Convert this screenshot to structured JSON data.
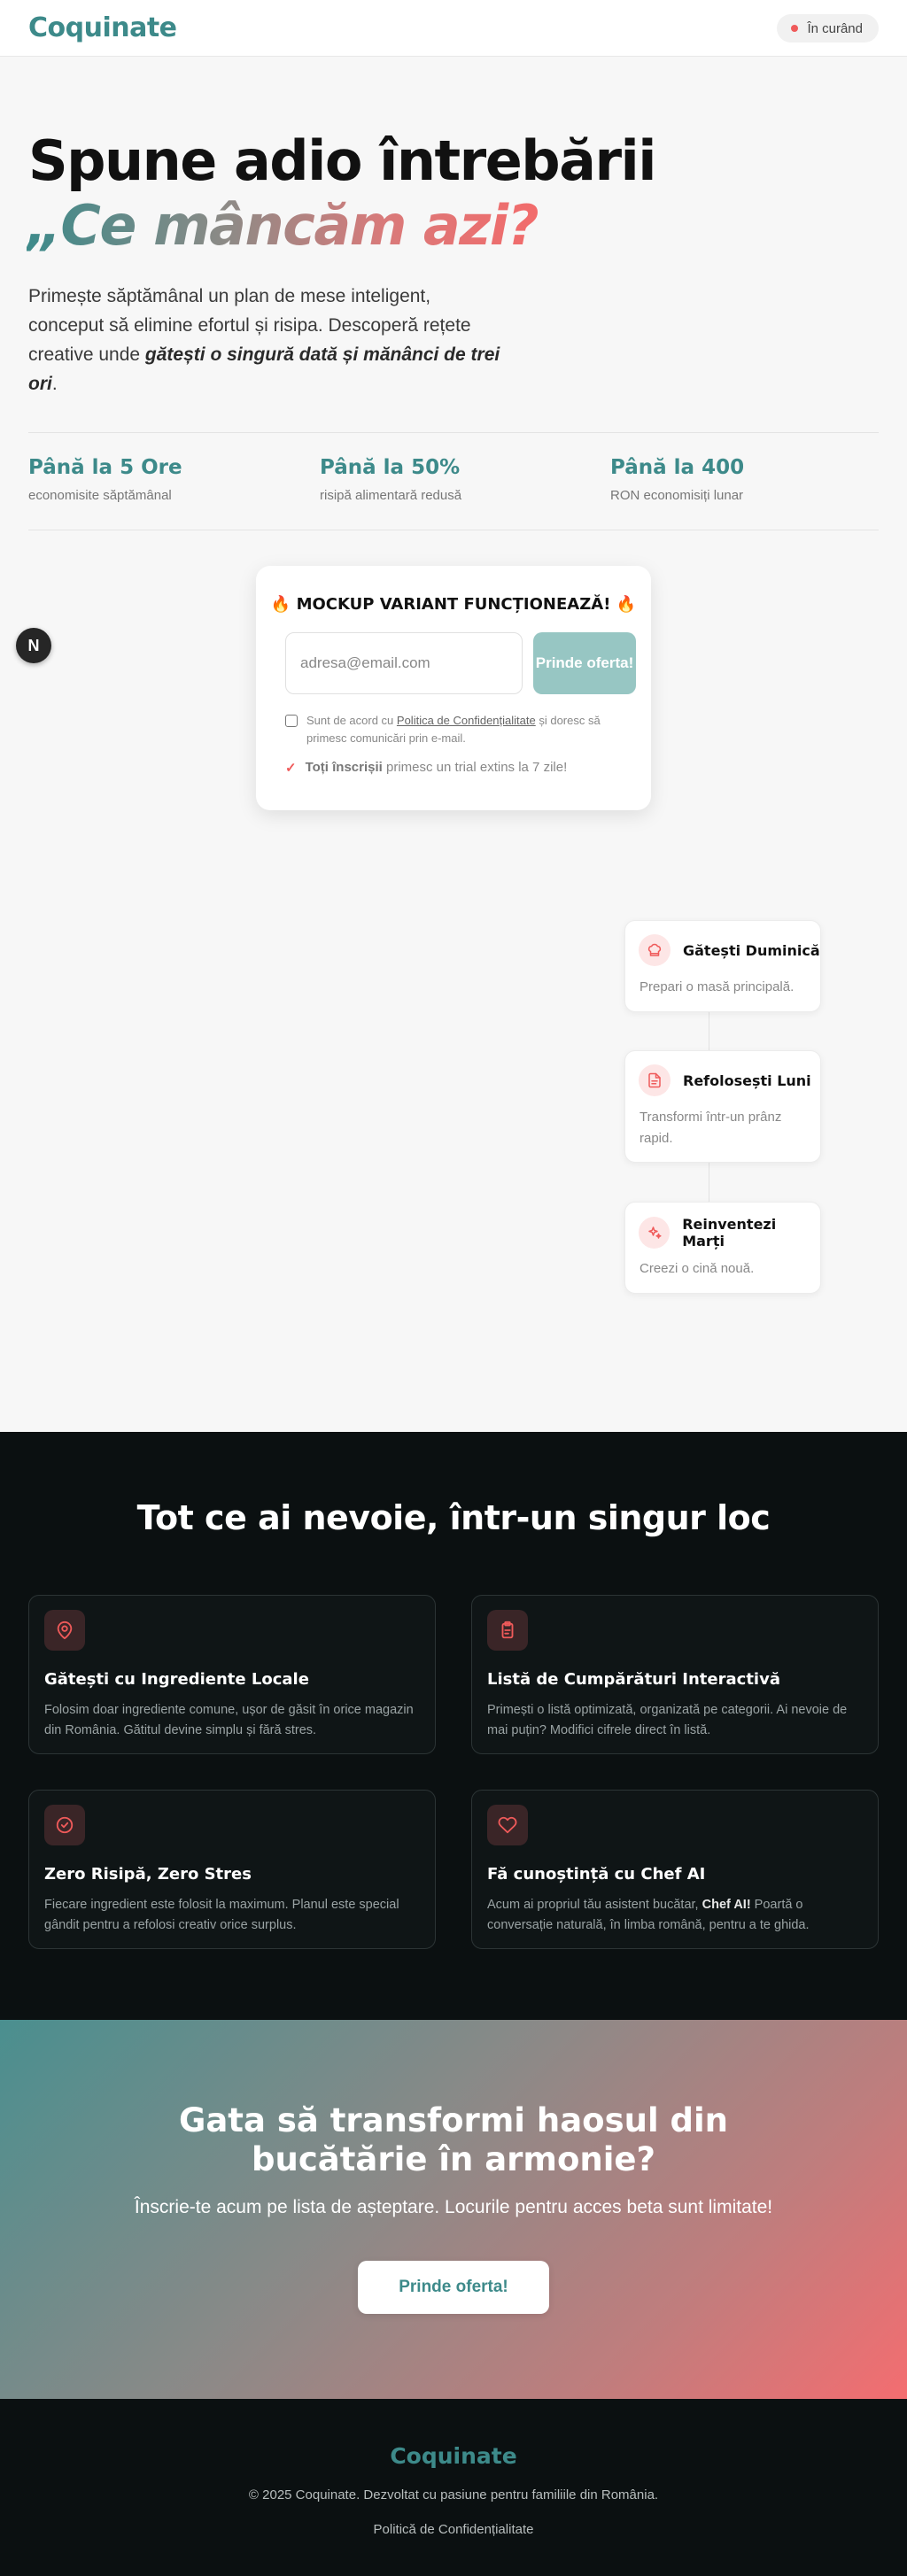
{
  "header": {
    "logo": "Coquinate",
    "badge_label": "În curând"
  },
  "hero": {
    "title": "Spune adio întrebării",
    "accent": "„Ce mâncăm azi?",
    "desc_before": "Primește săptămânal un plan de mese inteligent, conceput să elimine efortul și risipa. Descoperă rețete creative unde ",
    "desc_bold": "gătești o singură dată și mănânci de trei ori",
    "desc_after": "."
  },
  "stats": [
    {
      "value": "Până la 5 Ore",
      "label": "economisite săptămânal"
    },
    {
      "value": "Până la 50%",
      "label": "risipă alimentară redusă"
    },
    {
      "value": "Până la 400",
      "label": "RON economisiți lunar"
    }
  ],
  "floating_button": {
    "label": "N"
  },
  "mockup": {
    "title": "🔥 MOCKUP VARIANT FUNCȚIONEAZĂ! 🔥",
    "email_placeholder": "adresa@email.com",
    "email_value": "",
    "submit_label": "Prinde oferta!",
    "consent_before": "Sunt de acord cu ",
    "consent_link": "Politica de Confidențialitate",
    "consent_after": " și doresc să primesc comunicări prin e-mail.",
    "trial_bold": "Toți înscrișii",
    "trial_rest": " primesc un trial extins la 7 zile!"
  },
  "workflow": [
    {
      "title": "Gătești Duminică",
      "desc": "Prepari o masă principală.",
      "icon": "chef-hat-icon"
    },
    {
      "title": "Refolosești Luni",
      "desc": "Transformi într-un prânz rapid.",
      "icon": "document-icon"
    },
    {
      "title": "Reinventezi Marți",
      "desc": "Creezi o cină nouă.",
      "icon": "sparkles-icon"
    }
  ],
  "features": {
    "title": "Tot ce ai nevoie, într-un singur loc",
    "items": [
      {
        "title": "Gătești cu Ingrediente Locale",
        "desc": "Folosim doar ingrediente comune, ușor de găsit în orice magazin din România. Gătitul devine simplu și fără stres.",
        "icon": "map-pin-icon"
      },
      {
        "title": "Listă de Cumpărături Interactivă",
        "desc": "Primești o listă optimizată, organizată pe categorii. Ai nevoie de mai puțin? Modifici cifrele direct în listă.",
        "icon": "clipboard-icon"
      },
      {
        "title": "Zero Risipă, Zero Stres",
        "desc": "Fiecare ingredient este folosit la maximum. Planul este special gândit pentru a refolosi creativ orice surplus.",
        "icon": "check-circle-icon"
      },
      {
        "title": "Fă cunoștință cu Chef AI",
        "desc_before": "Acum ai propriul tău asistent bucătar, ",
        "desc_bold": "Chef AI!",
        "desc_after": " Poartă o conversație naturală, în limba română, pentru a te ghida.",
        "icon": "heart-icon"
      }
    ]
  },
  "cta": {
    "title": "Gata să transformi haosul din bucătărie în armonie?",
    "subtitle": "Înscrie-te acum pe lista de așteptare. Locurile pentru acces beta sunt limitate!",
    "button": "Prinde oferta!"
  },
  "footer": {
    "logo": "Coquinate",
    "copyright": "© 2025 Coquinate. Dezvoltat cu pasiune pentru familiile din România.",
    "privacy_link": "Politică de Confidențialitate"
  },
  "colors": {
    "brand": "#3d8a8a",
    "accent_coral": "#ef5a5a",
    "dark_bg": "#0b1011"
  }
}
